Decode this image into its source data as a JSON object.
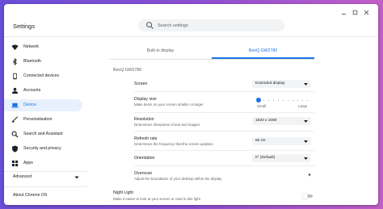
{
  "app": {
    "title": "Settings"
  },
  "search": {
    "placeholder": "Search settings"
  },
  "sidebar": {
    "items": [
      {
        "label": "Network",
        "icon": "wifi-icon"
      },
      {
        "label": "Bluetooth",
        "icon": "bluetooth-icon"
      },
      {
        "label": "Connected devices",
        "icon": "phone-icon"
      },
      {
        "label": "Accounts",
        "icon": "person-icon"
      },
      {
        "label": "Device",
        "icon": "laptop-icon"
      },
      {
        "label": "Personalisation",
        "icon": "brush-icon"
      },
      {
        "label": "Search and Assistant",
        "icon": "search-icon"
      },
      {
        "label": "Security and privacy",
        "icon": "shield-icon"
      },
      {
        "label": "Apps",
        "icon": "apps-grid-icon"
      }
    ],
    "advanced_label": "Advanced",
    "about_label": "About Chrome OS"
  },
  "tabs": {
    "builtin": "Built-in display",
    "external": "BenQ GW2780"
  },
  "display_name": "BenQ GW2780",
  "rows": {
    "screen": {
      "label": "Screen",
      "value": "Extended display"
    },
    "display_size": {
      "label": "Display size",
      "desc": "Make items on your screen smaller or larger",
      "small": "Small",
      "large": "Large",
      "slider_position": 0
    },
    "resolution": {
      "label": "Resolution",
      "desc": "Determines sharpness of text and images",
      "value": "1920 x 1080"
    },
    "refresh_rate": {
      "label": "Refresh rate",
      "desc": "Determines the frequency that the screen updates",
      "value": "60 Hz"
    },
    "orientation": {
      "label": "Orientation",
      "value": "0° (Default)"
    },
    "overscan": {
      "label": "Overscan",
      "desc": "Adjust the boundaries of your desktop within the display"
    }
  },
  "night_light": {
    "label": "Night Light",
    "desc": "Make it easier to look at your screen or read in dim light",
    "enabled": false
  },
  "colors": {
    "accent": "#1a73e8",
    "active_bg": "#e8f0fe",
    "text": "#202124",
    "secondary": "#5f6368"
  }
}
